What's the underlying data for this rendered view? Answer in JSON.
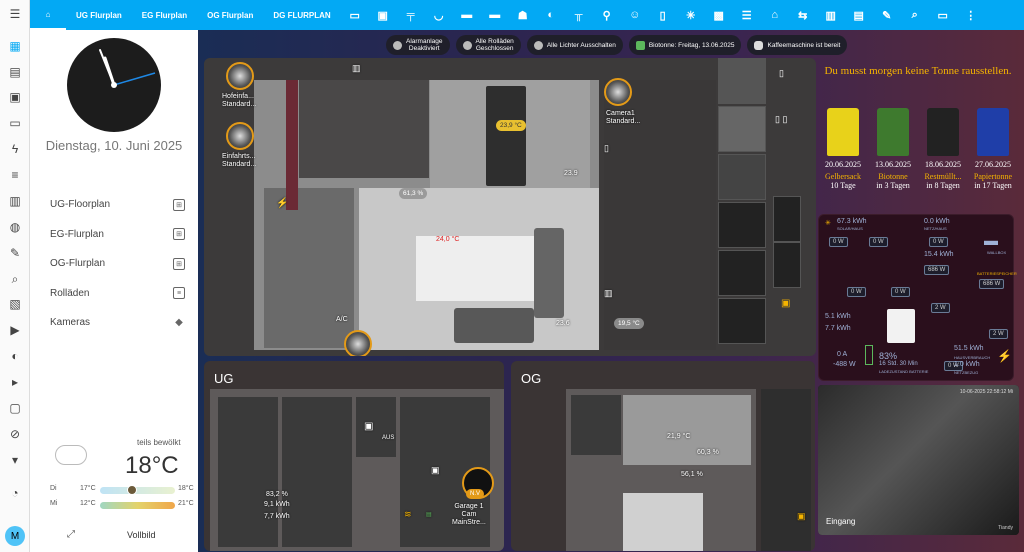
{
  "header": {
    "tabs": [
      "UG Flurplan",
      "EG Flurplan",
      "OG Flurplan",
      "DG FLURPLAN"
    ]
  },
  "sidebar": {
    "date": "Dienstag, 10. Juni 2025",
    "items": [
      {
        "label": "UG-Floorplan"
      },
      {
        "label": "EG-Flurplan"
      },
      {
        "label": "OG-Flurplan"
      },
      {
        "label": "Rolläden"
      },
      {
        "label": "Kameras"
      }
    ],
    "weather": {
      "condition": "teils bewölkt",
      "temp": "18°C",
      "rows": [
        {
          "day": "Di",
          "low": "17°C",
          "high": "18°C"
        },
        {
          "day": "Mi",
          "low": "12°C",
          "high": "21°C"
        }
      ]
    },
    "fullscreen": "Vollbild",
    "avatar": "M"
  },
  "chips": [
    {
      "line1": "Alarmanlage",
      "line2": "Deaktiviert"
    },
    {
      "line1": "Alle Rolläden",
      "line2": "Geschlossen"
    },
    {
      "line1": "Alle Lichter Ausschalten",
      "line2": ""
    },
    {
      "line1": "Biotonne: Freitag, 13.06.2025",
      "line2": ""
    },
    {
      "line1": "Kaffeemaschine ist bereit",
      "line2": ""
    }
  ],
  "floorplan": {
    "cameras": [
      {
        "label": "Hofeinfa...",
        "sub": "Standard..."
      },
      {
        "label": "Einfahrts...",
        "sub": "Standard..."
      },
      {
        "label": "Camera1",
        "sub": "Standard..."
      }
    ],
    "readings": {
      "dining": "23,9 °C",
      "dining2": "23.9",
      "humidity": "61,3 %",
      "living": "24,0 °C",
      "living2": "23.6",
      "outdoor": "19,5 °C",
      "ac": "A/C"
    }
  },
  "waste": {
    "title": "Du musst morgen keine Tonne rausstellen.",
    "bins": [
      {
        "date": "20.06.2025",
        "name": "Gelbersack",
        "countdown": "10 Tage",
        "color": "#e8d21a",
        "namecolor": "#f5b400"
      },
      {
        "date": "13.06.2025",
        "name": "Biotonne",
        "countdown": "in 3 Tagen",
        "color": "#3e7a2e",
        "namecolor": "#f5b400"
      },
      {
        "date": "18.06.2025",
        "name": "Restmüllt...",
        "countdown": "in 8 Tagen",
        "color": "#222222",
        "namecolor": "#f5b400"
      },
      {
        "date": "27.06.2025",
        "name": "Papiertonne",
        "countdown": "in 17 Tagen",
        "color": "#1f3ea8",
        "namecolor": "#f5b400"
      }
    ]
  },
  "energy": {
    "solar": "67.3 kWh",
    "solar_lbl": "SOLAR/HAUS",
    "grid": "0.0 kWh",
    "grid_lbl": "NETZ/HAUS",
    "w_values": [
      "0 W",
      "0 W",
      "0 W",
      "15.4 kWh",
      "686 W",
      "0 W",
      "0 W",
      "2 W",
      "686 W",
      "2 W",
      "0 W"
    ],
    "wallbox": "WALLBOX",
    "battery_lbl": "BATTERIESPEICHER",
    "battery_kwh": "5.1 kWh",
    "battery_kwh2": "7.7 kWh",
    "batt_in": "0 A",
    "batt_w": "-488 W",
    "soc": "83%",
    "soc_time": "16 Std. 30 Min",
    "soc_sub": "LADEZUSTAND BATTERIE",
    "house": "51.5 kWh",
    "house2": "1.0 kWh",
    "house_lbl": "HAUSVERBRAUCH",
    "house2_lbl": "NETZBEZUG"
  },
  "ug": {
    "title": "UG",
    "humidity": "83,2 %",
    "kwh1": "9,1 kWh",
    "kwh2": "7,7 kWh",
    "aus": "AUS",
    "garage": {
      "line1": "Garage 1",
      "line2": "Cam",
      "line3": "MainStre...",
      "badge": "N.V"
    }
  },
  "og": {
    "title": "OG",
    "temp": "21,9 °C",
    "hum1": "60,3 %",
    "hum2": "56,1 %"
  },
  "feed": {
    "label": "Eingang",
    "timestamp": "10-06-2025 22:58:12 Mi",
    "brand": "Tiandy"
  }
}
